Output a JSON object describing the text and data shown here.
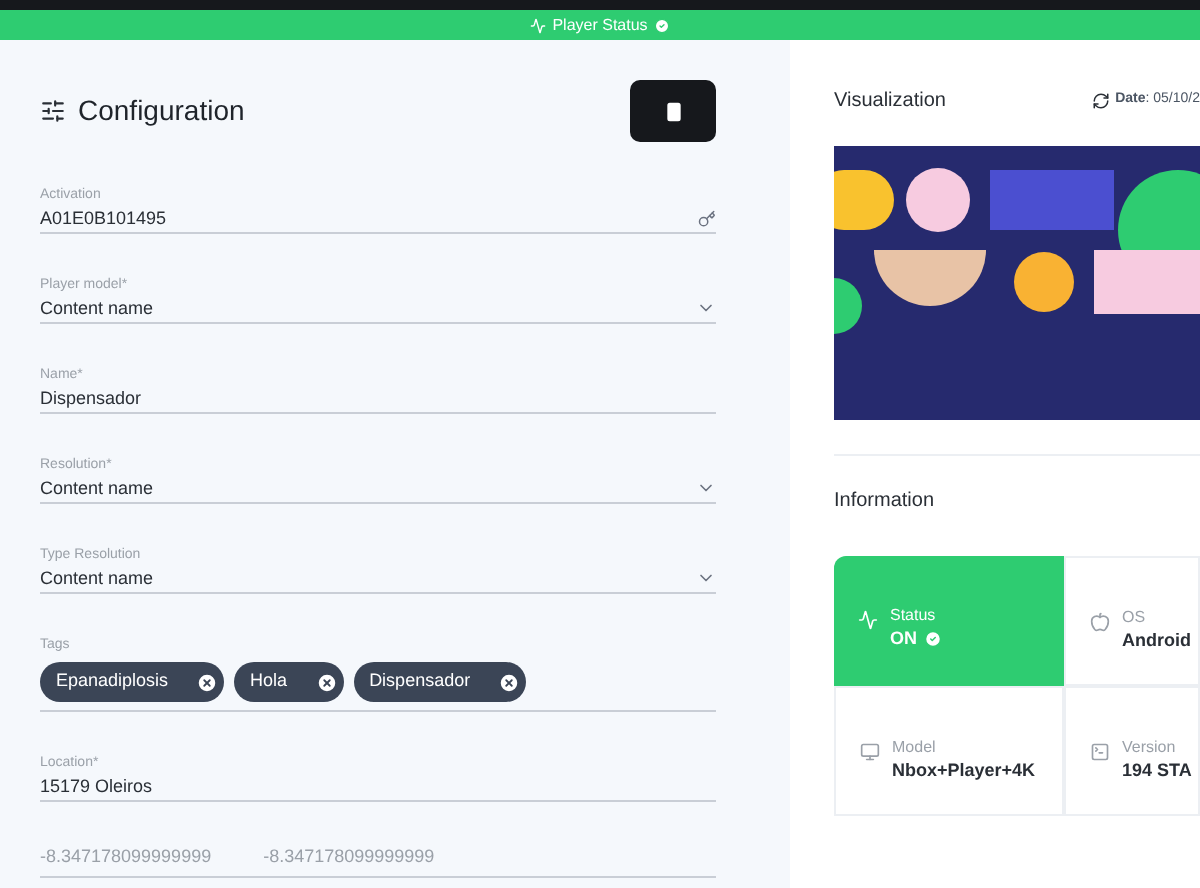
{
  "status_bar": {
    "label": "Player Status"
  },
  "configuration": {
    "title": "Configuration",
    "fields": [
      {
        "kind": "key",
        "label": "Activation",
        "value": "A01E0B101495"
      },
      {
        "kind": "select",
        "label": "Player model*",
        "value": "Content name"
      },
      {
        "kind": "text",
        "label": "Name*",
        "value": "Dispensador"
      },
      {
        "kind": "select",
        "label": "Resolution*",
        "value": "Content name"
      },
      {
        "kind": "select",
        "label": "Type Resolution",
        "value": "Content name"
      },
      {
        "kind": "tags",
        "label": "Tags",
        "tags": [
          "Epanadiplosis",
          "Hola",
          "Dispensador"
        ]
      },
      {
        "kind": "text",
        "label": "Location*",
        "value": "15179 Oleiros"
      },
      {
        "kind": "coords",
        "values": [
          "-8.347178099999999",
          "-8.347178099999999"
        ]
      }
    ]
  },
  "visualization": {
    "title": "Visualization",
    "date": "**Date**: 05/10/2"
  },
  "information": {
    "title": "Information",
    "cards": [
      {
        "kind": "status",
        "label": "Status",
        "value": "ON"
      },
      {
        "kind": "os",
        "label": "OS",
        "value": "Android"
      },
      {
        "kind": "model",
        "label": "Model",
        "value": "Nbox+Player+4K"
      },
      {
        "kind": "version",
        "label": "Version",
        "value": "194 STA"
      }
    ]
  }
}
